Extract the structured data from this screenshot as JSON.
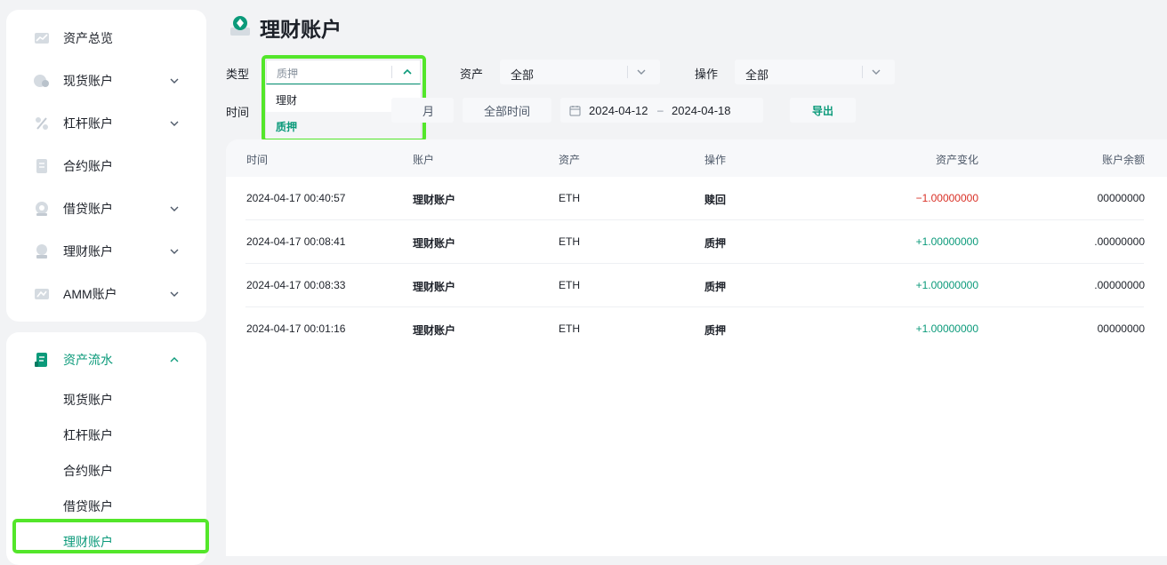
{
  "sidebar": {
    "items": [
      {
        "label": "资产总览"
      },
      {
        "label": "现货账户"
      },
      {
        "label": "杠杆账户"
      },
      {
        "label": "合约账户"
      },
      {
        "label": "借贷账户"
      },
      {
        "label": "理财账户"
      },
      {
        "label": "AMM账户"
      }
    ],
    "flow": {
      "label": "资产流水",
      "sub_items": [
        {
          "label": "现货账户"
        },
        {
          "label": "杠杆账户"
        },
        {
          "label": "合约账户"
        },
        {
          "label": "借贷账户"
        },
        {
          "label": "理财账户"
        }
      ]
    }
  },
  "header": {
    "title": "理财账户"
  },
  "filters": {
    "type": {
      "label": "类型",
      "value": "质押",
      "options": [
        "理财",
        "质押"
      ]
    },
    "asset": {
      "label": "资产",
      "value": "全部"
    },
    "operation": {
      "label": "操作",
      "value": "全部"
    },
    "time": {
      "label": "时间",
      "month_partial": "月",
      "all_time": "全部时间",
      "start": "2024-04-12",
      "range_sep": "–",
      "end": "2024-04-18"
    },
    "export_label": "导出"
  },
  "table": {
    "columns": [
      "时间",
      "账户",
      "资产",
      "操作",
      "资产变化",
      "账户余额"
    ],
    "rows": [
      {
        "time": "2024-04-17 00:40:57",
        "account": "理财账户",
        "asset": "ETH",
        "op": "赎回",
        "change": "−1.00000000",
        "balance": "00000000"
      },
      {
        "time": "2024-04-17 00:08:41",
        "account": "理财账户",
        "asset": "ETH",
        "op": "质押",
        "change": "+1.00000000",
        "balance": ".00000000"
      },
      {
        "time": "2024-04-17 00:08:33",
        "account": "理财账户",
        "asset": "ETH",
        "op": "质押",
        "change": "+1.00000000",
        "balance": ".00000000"
      },
      {
        "time": "2024-04-17 00:01:16",
        "account": "理财账户",
        "asset": "ETH",
        "op": "质押",
        "change": "+1.00000000",
        "balance": "00000000"
      }
    ]
  },
  "colors": {
    "accent": "#0b9a7a",
    "negative": "#d93026",
    "highlight": "#53e62a"
  }
}
